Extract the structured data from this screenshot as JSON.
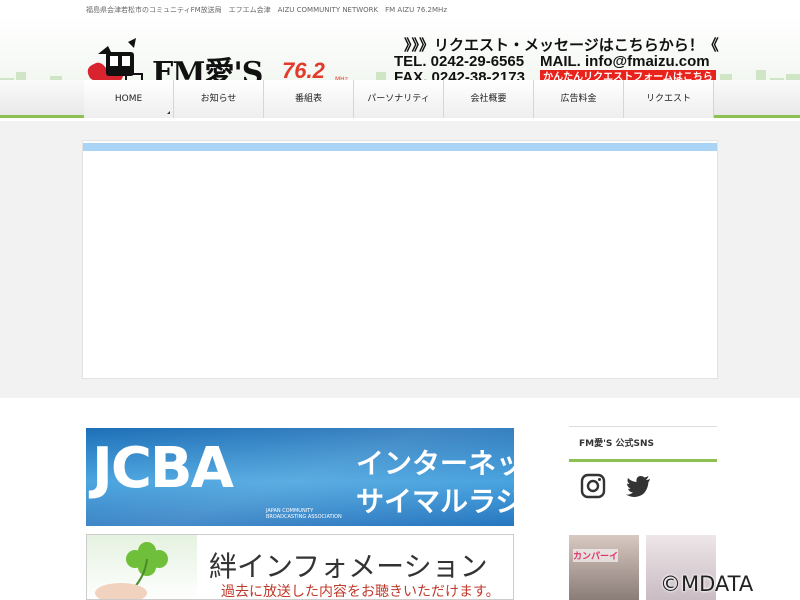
{
  "tagline": "福島県会津若松市のコミュニティFM放送局　エフエム会津　AIZU COMMUNITY NETWORK　FM AIZU 76.2MHz",
  "logo": {
    "text": "FM愛'S",
    "freq": "76.2",
    "unit": "MHz"
  },
  "contact": {
    "request_heading": "》》》リクエスト・メッセージはこちらから！《",
    "tel": "TEL. 0242-29-6565",
    "mail": "MAIL. info@fmaizu.com",
    "fax": "FAX. 0242-38-2173",
    "request_form_button": "かんたんリクエストフォームはこちら"
  },
  "nav": {
    "items": [
      {
        "label": "HOME"
      },
      {
        "label": "お知らせ"
      },
      {
        "label": "番組表"
      },
      {
        "label": "パーソナリティ"
      },
      {
        "label": "会社概要"
      },
      {
        "label": "広告料金"
      },
      {
        "label": "リクエスト"
      }
    ]
  },
  "banners": {
    "jcba": {
      "logo": "JCBA",
      "sub": "JAPAN COMMUNITY BROADCASTING ASSOCIATION",
      "line1": "インターネット",
      "line2": "サイマルラジオ"
    },
    "kizuna": {
      "title": "絆インフォメーション",
      "subtitle": "過去に放送した内容をお聴きいただけます。"
    }
  },
  "sidebar": {
    "sns_title": "FM愛'S 公式SNS",
    "instagram_icon": "instagram-icon",
    "twitter_icon": "twitter-icon",
    "thumb_label": "カンパーイ"
  },
  "watermark": "©MDATA",
  "colors": {
    "accent_green": "#8cc152",
    "request_red": "#e8231b",
    "hero_bar": "#a9d4f5",
    "jcba_blue": "#1d6fb7"
  }
}
